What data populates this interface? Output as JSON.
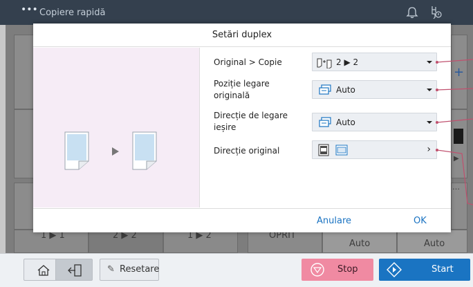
{
  "topbar": {
    "title": "Copiere rapidă",
    "menu_icon": "ellipsis-icon"
  },
  "background": {
    "bottom_cells": [
      "1 ▶ 1",
      "2 ▶ 2",
      "1 ▶ 2",
      "OPRIT",
      "Auto",
      "Auto"
    ]
  },
  "dialog": {
    "title": "Setări duplex",
    "rows": [
      {
        "label": "Original > Copie",
        "value": "2 ▶ 2",
        "control": "dropdown"
      },
      {
        "label": "Poziție legare originală",
        "value": "Auto",
        "control": "dropdown"
      },
      {
        "label": "Direcție de legare ieșire",
        "value": "Auto",
        "control": "dropdown"
      },
      {
        "label": "Direcție original",
        "value": "",
        "control": "submenu"
      }
    ],
    "cancel_label": "Anulare",
    "ok_label": "OK"
  },
  "bottombar": {
    "reset_label": "Resetare",
    "stop_label": "Stop",
    "start_label": "Start"
  },
  "colors": {
    "topbar": "#34404e",
    "stop": "#f08aa2",
    "start": "#1a74c2",
    "callout": "#c0506e",
    "preview_bg": "#f6ecf6"
  }
}
